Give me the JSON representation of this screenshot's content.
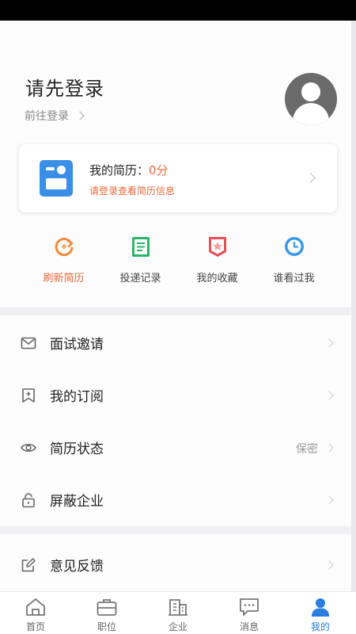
{
  "header": {
    "title": "请先登录",
    "login_link": "前往登录"
  },
  "resume_card": {
    "label": "我的简历：",
    "score": "0分",
    "hint": "请登录查看简历信息"
  },
  "quick_actions": [
    {
      "label": "刷新简历",
      "icon": "refresh-icon",
      "color": "#ea6a3a"
    },
    {
      "label": "投递记录",
      "icon": "document-list-icon",
      "color": "#2fb46b"
    },
    {
      "label": "我的收藏",
      "icon": "star-badge-icon",
      "color": "#e6505a"
    },
    {
      "label": "谁看过我",
      "icon": "clock-icon",
      "color": "#3a9ae6"
    }
  ],
  "menu": [
    {
      "label": "面试邀请",
      "icon": "mail-icon",
      "value": ""
    },
    {
      "label": "我的订阅",
      "icon": "bookmark-plus-icon",
      "value": ""
    },
    {
      "label": "简历状态",
      "icon": "eye-icon",
      "value": "保密"
    },
    {
      "label": "屏蔽企业",
      "icon": "lock-icon",
      "value": ""
    },
    {
      "label": "意见反馈",
      "icon": "edit-icon",
      "value": ""
    }
  ],
  "tabs": [
    {
      "label": "首页",
      "icon": "home-icon"
    },
    {
      "label": "职位",
      "icon": "briefcase-icon"
    },
    {
      "label": "企业",
      "icon": "building-icon"
    },
    {
      "label": "消息",
      "icon": "message-icon"
    },
    {
      "label": "我的",
      "icon": "person-icon",
      "active": true
    }
  ],
  "colors": {
    "accent": "#2a7de1",
    "orange": "#ea6a3a"
  }
}
